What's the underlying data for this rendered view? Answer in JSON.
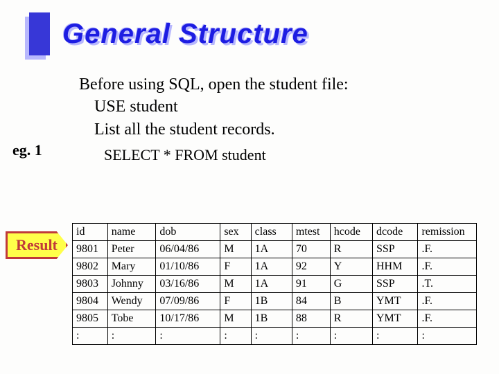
{
  "title": "General Structure",
  "body": {
    "line1": "Before using SQL, open the student file:",
    "line2": "USE student",
    "line3": "List all the student records.",
    "line4": "SELECT * FROM student"
  },
  "badges": {
    "eg": "eg. 1",
    "result": "Result"
  },
  "table": {
    "headers": [
      "id",
      "name",
      "dob",
      "sex",
      "class",
      "mtest",
      "hcode",
      "dcode",
      "remission"
    ],
    "rows": [
      [
        "9801",
        "Peter",
        "06/04/86",
        "M",
        "1A",
        "70",
        "R",
        "SSP",
        ".F."
      ],
      [
        "9802",
        "Mary",
        "01/10/86",
        "F",
        "1A",
        "92",
        "Y",
        "HHM",
        ".F."
      ],
      [
        "9803",
        "Johnny",
        "03/16/86",
        "M",
        "1A",
        "91",
        "G",
        "SSP",
        ".T."
      ],
      [
        "9804",
        "Wendy",
        "07/09/86",
        "F",
        "1B",
        "84",
        "B",
        "YMT",
        ".F."
      ],
      [
        "9805",
        "Tobe",
        "10/17/86",
        "M",
        "1B",
        "88",
        "R",
        "YMT",
        ".F."
      ],
      [
        ":",
        ":",
        ":",
        ":",
        ":",
        ":",
        ":",
        ":",
        ":"
      ]
    ]
  }
}
